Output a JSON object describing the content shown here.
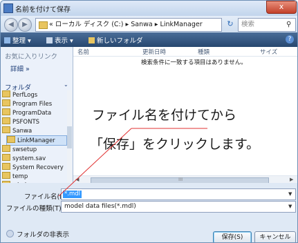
{
  "window": {
    "title": "名前を付けて保存",
    "close_glyph": "x"
  },
  "navbar": {
    "back_glyph": "◀",
    "forward_glyph": "▶",
    "address_path": "« ローカル ディスク (C:) ▸ Sanwa ▸ LinkManager",
    "address_drop": "▼",
    "refresh_glyph": "↻",
    "search_placeholder": "検索",
    "search_glyph": "⚲"
  },
  "toolbar": {
    "organize": "整理 ▾",
    "view": "表示 ▾",
    "new_folder": "新しいフォルダ",
    "help_glyph": "?"
  },
  "sidebar": {
    "favorites_title": "お気に入りリンク",
    "details_label": "詳細 »",
    "folders_title": "フォルダ",
    "folders_chevron": "⌄",
    "tree": [
      {
        "label": "PerfLogs",
        "selected": false
      },
      {
        "label": "Program Files",
        "selected": false
      },
      {
        "label": "ProgramData",
        "selected": false
      },
      {
        "label": "PSFONTS",
        "selected": false
      },
      {
        "label": "Sanwa",
        "selected": false
      },
      {
        "label": "LinkManager",
        "selected": true
      },
      {
        "label": "swsetup",
        "selected": false
      },
      {
        "label": "system.sav",
        "selected": false
      },
      {
        "label": "System Recovery",
        "selected": false
      },
      {
        "label": "temp",
        "selected": false
      },
      {
        "label": "windows",
        "selected": false
      }
    ]
  },
  "main": {
    "columns": [
      "名前",
      "更新日時",
      "種類",
      "サイズ"
    ],
    "empty_message": "検索条件に一致する項目はありません。",
    "scroll_left": "◀",
    "scroll_right": "▶",
    "scroll_mid": "III"
  },
  "annotation": {
    "line1": "ファイル名を付けてから",
    "line2": "「保存」をクリックします。",
    "color": "#e03030"
  },
  "bottom": {
    "filename_label": "ファイル名(N):",
    "filename_value": "*.mdl",
    "filetype_label": "ファイルの種類(T):",
    "filetype_value": "model data files(*.mdl)",
    "dropdown_glyph": "▼",
    "hide_folders_label": "フォルダの非表示",
    "save_label": "保存(S)",
    "cancel_label": "キャンセル"
  }
}
